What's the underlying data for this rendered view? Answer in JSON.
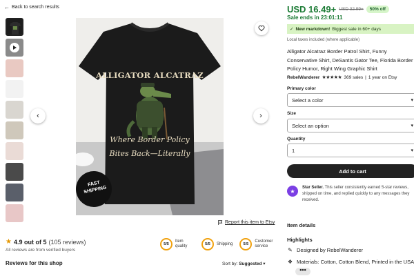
{
  "nav": {
    "back_label": "Back to search results"
  },
  "gallery": {
    "thumbnails": [
      {
        "kind": "image",
        "active": true
      },
      {
        "kind": "video",
        "active": false
      },
      {
        "kind": "image",
        "active": false
      },
      {
        "kind": "image",
        "active": false
      },
      {
        "kind": "image",
        "active": false
      },
      {
        "kind": "image",
        "active": false
      },
      {
        "kind": "image",
        "active": false
      },
      {
        "kind": "image",
        "active": false
      },
      {
        "kind": "image",
        "active": false
      },
      {
        "kind": "image",
        "active": false
      }
    ],
    "shirt_headline": "ALLIGATOR ALCATRAZ",
    "shirt_tagline_1": "Where Border Policy",
    "shirt_tagline_2": "Bites Back—Literally",
    "badge_line_1": "FAST",
    "badge_line_2": "SHIPPING",
    "report_label": "Report this item to Etsy"
  },
  "reviews": {
    "score": "4.9 out of 5",
    "count": "(105 reviews)",
    "verified_note": "All reviews are from verified buyers",
    "section_title": "Reviews for this shop",
    "sort_prefix": "Sort by:",
    "sort_value": "Suggested",
    "badges": [
      {
        "score": "5/5",
        "label": "Item quality"
      },
      {
        "score": "5/5",
        "label": "Shipping"
      },
      {
        "score": "5/5",
        "label": "Customer service"
      }
    ]
  },
  "product": {
    "price": "USD 16.49+",
    "old_price": "USD 32.99+",
    "discount": "50% off",
    "sale_ends": "Sale ends in 23:01:11",
    "markdown_bold": "New markdown!",
    "markdown_rest": "Biggest sale in 60+ days",
    "taxes_note": "Local taxes included (where applicable)",
    "title": "Alligator Alcatraz Border Patrol Shirt, Funny Conservative Shirt, DeSantis Gator Tee, Florida Border Policy Humor, Right Wing Graphic Shirt",
    "seller_name": "RebelWanderer",
    "seller_stars": "★★★★★",
    "sales": "369 sales",
    "tenure": "1 year on Etsy",
    "options": {
      "color_label": "Primary color",
      "color_value": "Select a color",
      "size_label": "Size",
      "size_value": "Select an option",
      "qty_label": "Quantity",
      "qty_value": "1"
    },
    "add_to_cart": "Add to cart",
    "star_seller_title": "Star Seller.",
    "star_seller_text": "This seller consistently earned 5-star reviews, shipped on time, and replied quickly to any messages they received.",
    "item_details": "Item details",
    "highlights_title": "Highlights",
    "designed_by": "Designed by RebelWanderer",
    "materials": "Materials: Cotton, Cotton Blend, Printed in the USA",
    "more": "•••"
  },
  "colors": {
    "price_green": "#1a7a33",
    "markdown_bg": "#d8f3c3",
    "star_seller_purple": "#7b3fe4",
    "rating_gold": "#f1a10d"
  }
}
